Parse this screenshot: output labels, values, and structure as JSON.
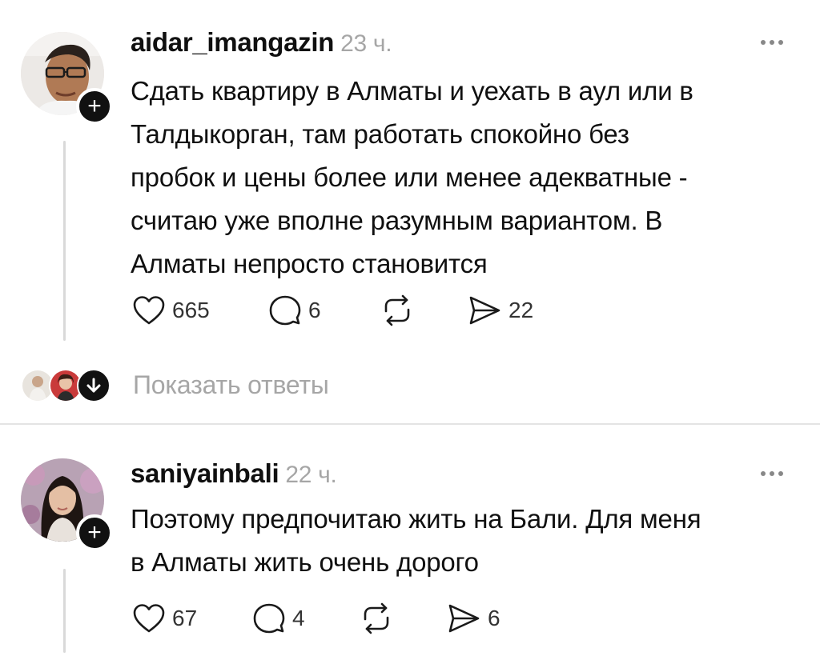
{
  "posts": [
    {
      "username": "aidar_imangazin",
      "time": "23 ч.",
      "text_lines": [
        "Сдать квартиру в Алматы и уехать в аул или в",
        "Талдыкорган, там работать спокойно без",
        "пробок и цены более или менее адекватные -",
        "считаю уже вполне разумным вариантом. В",
        "Алматы непросто становится"
      ],
      "likes": "665",
      "comments": "6",
      "shares": "22"
    },
    {
      "username": "saniyainbali",
      "time": "22 ч.",
      "text_lines": [
        "Поэтому предпочитаю жить на Бали. Для меня",
        "в Алматы жить очень дорого"
      ],
      "likes": "67",
      "comments": "4",
      "shares": "6"
    }
  ],
  "show_replies_label": "Показать ответы",
  "icons": {
    "follow": "plus-icon",
    "like": "heart-icon",
    "comment": "comment-icon",
    "repost": "repost-icon",
    "share": "send-icon",
    "more": "more-dots-icon",
    "expand": "arrow-down-icon"
  },
  "colors": {
    "text": "#101010",
    "muted": "#a6a6a6",
    "divider": "#e4e4e4",
    "badge": "#111111"
  }
}
